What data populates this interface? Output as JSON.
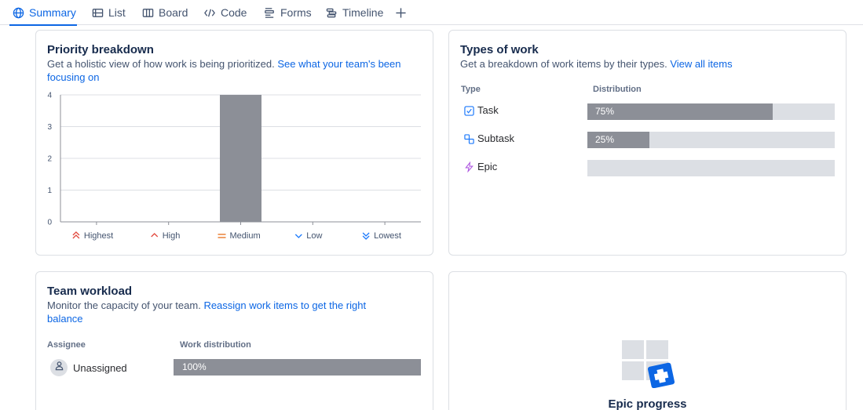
{
  "tabs": [
    {
      "label": "Summary",
      "icon": "globe-icon",
      "active": true
    },
    {
      "label": "List",
      "icon": "list-icon"
    },
    {
      "label": "Board",
      "icon": "board-icon"
    },
    {
      "label": "Code",
      "icon": "code-icon"
    },
    {
      "label": "Forms",
      "icon": "forms-icon"
    },
    {
      "label": "Timeline",
      "icon": "timeline-icon"
    }
  ],
  "add_tab_icon": "plus-icon",
  "priority": {
    "title": "Priority breakdown",
    "desc": "Get a holistic view of how work is being prioritized.",
    "link": "See what your team's been focusing on",
    "chart_data": {
      "type": "bar",
      "categories": [
        "Highest",
        "High",
        "Medium",
        "Low",
        "Lowest"
      ],
      "values": [
        0,
        0,
        4,
        0,
        0
      ],
      "yticks": [
        "0",
        "1",
        "2",
        "3",
        "4"
      ],
      "ylim": [
        0,
        4
      ],
      "bar_color": "#8c8f97",
      "category_icons": [
        "double-chevron-up-icon",
        "chevron-up-icon",
        "equals-icon",
        "chevron-down-icon",
        "double-chevron-down-icon"
      ],
      "category_colors": [
        "#e2483d",
        "#e2483d",
        "#e56910",
        "#1d7afc",
        "#1d7afc"
      ]
    }
  },
  "types": {
    "title": "Types of work",
    "desc": "Get a breakdown of work items by their types.",
    "link": "View all items",
    "col_type": "Type",
    "col_dist": "Distribution",
    "rows": [
      {
        "label": "Task",
        "icon": "task-checkbox-icon",
        "percent": 75,
        "percent_label": "75%"
      },
      {
        "label": "Subtask",
        "icon": "subtask-icon",
        "percent": 25,
        "percent_label": "25%"
      },
      {
        "label": "Epic",
        "icon": "epic-lightning-icon",
        "percent": 0,
        "percent_label": ""
      }
    ]
  },
  "workload": {
    "title": "Team workload",
    "desc": "Monitor the capacity of your team.",
    "link": "Reassign work items to get the right balance",
    "col_assignee": "Assignee",
    "col_dist": "Work distribution",
    "rows": [
      {
        "name": "Unassigned",
        "percent": 100,
        "percent_label": "100%"
      }
    ]
  },
  "epic": {
    "title": "Epic progress"
  },
  "colors": {
    "accent": "#0c66e4",
    "bar": "#8c8f97",
    "track": "#dcdfe4"
  }
}
